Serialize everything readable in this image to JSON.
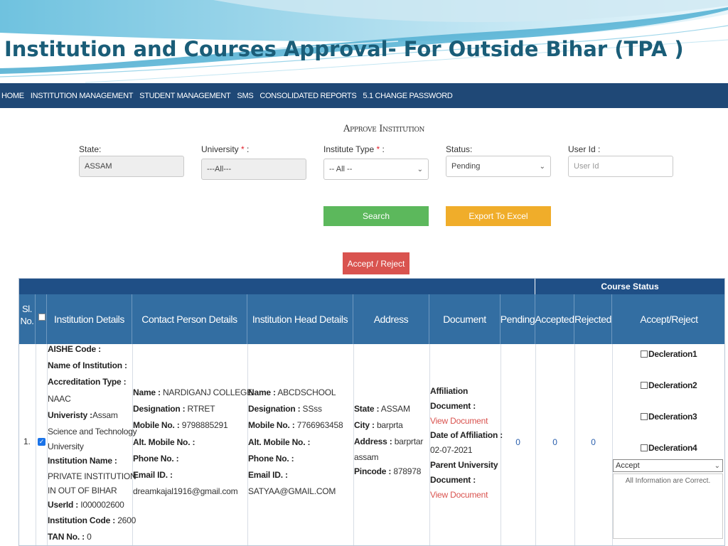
{
  "slide": {
    "title": "Institution and Courses Approval- For Outside Bihar (TPA )"
  },
  "nav": {
    "items": [
      "HOME",
      "INSTITUTION MANAGEMENT",
      "STUDENT MANAGEMENT",
      "SMS",
      "CONSOLIDATED REPORTS",
      "5.1 CHANGE PASSWORD"
    ]
  },
  "page": {
    "heading": "Approve Institution"
  },
  "filters": {
    "state": {
      "label": "State:",
      "value": "ASSAM"
    },
    "university": {
      "label": "University",
      "required": "*",
      "colon": ":",
      "value": "---All---"
    },
    "institute_type": {
      "label": "Institute Type",
      "required": "*",
      "colon": ":",
      "value": "-- All --"
    },
    "status": {
      "label": "Status:",
      "value": "Pending"
    },
    "user_id": {
      "label": "User Id :",
      "placeholder": "User Id"
    }
  },
  "buttons": {
    "search": "Search",
    "export": "Export To Excel",
    "accept_reject": "Accept / Reject"
  },
  "table": {
    "group_header": "Course Status",
    "headers": {
      "sl_no": "Sl. No.",
      "institution": "Institution Details",
      "contact": "Contact Person Details",
      "head": "Institution Head Details",
      "address": "Address",
      "document": "Document",
      "pending": "Pending",
      "accepted": "Accepted",
      "rejected": "Rejected",
      "accept_reject": "Accept/Reject"
    },
    "row": {
      "sl": "1.",
      "institution": {
        "aishe_label": "AISHE Code :",
        "name_label": "Name of Institution :",
        "accreditation_label": "Accreditation Type :",
        "accreditation_value": "NAAC",
        "university_label": "Univeristy :",
        "university_value_1": "Assam",
        "university_value_2": "Science and Technology",
        "university_value_3": "University",
        "inst_name_label": "Institution Name :",
        "inst_name_value_1": "PRIVATE INSTITUTION",
        "inst_name_value_2": "IN OUT OF BIHAR",
        "userid_label": "UserId :",
        "userid_value": "I000002600",
        "code_label": "Institution Code :",
        "code_value": "2600",
        "tan_label": "TAN No. :",
        "tan_value": "0"
      },
      "contact": {
        "name_label": "Name :",
        "name_value": "NARDIGANJ COLLEGE",
        "designation_label": "Designation :",
        "designation_value": "RTRET",
        "mobile_label": "Mobile No. :",
        "mobile_value": "9798885291",
        "alt_mobile_label": "Alt. Mobile No. :",
        "phone_label": "Phone No. :",
        "email_label": "Email ID. :",
        "email_value": "dreamkajal1916@gmail.com"
      },
      "head": {
        "name_label": "Name :",
        "name_value": "ABCDSCHOOL",
        "designation_label": "Designation :",
        "designation_value": "SSss",
        "mobile_label": "Mobile No. :",
        "mobile_value": "7766963458",
        "alt_mobile_label": "Alt. Mobile No. :",
        "phone_label": "Phone No. :",
        "email_label": "Email ID. :",
        "email_value": "SATYAA@GMAIL.COM"
      },
      "address": {
        "state_label": "State :",
        "state_value": "ASSAM",
        "city_label": "City :",
        "city_value": "barprta",
        "address_label": "Address :",
        "address_value_1": "barprtar",
        "address_value_2": "assam",
        "pincode_label": "Pincode :",
        "pincode_value": "878978"
      },
      "document": {
        "affiliation_label_1": "Affiliation",
        "affiliation_label_2": "Document :",
        "view_1": "View Document",
        "date_label": "Date of Affiliation :",
        "date_value": "02-07-2021",
        "parent_label_1": "Parent University",
        "parent_label_2": "Document :",
        "view_2": "View Document"
      },
      "pending": "0",
      "accepted": "0",
      "rejected": "0",
      "declarations": [
        "Decleration1",
        "Decleration2",
        "Decleration3",
        "Decleration4"
      ],
      "status_value": "Accept",
      "remark": "All Information are Correct."
    }
  },
  "colors": {
    "nav_bg": "#1f4876",
    "header_bg": "#336ea2",
    "title": "#1a5d78",
    "search": "#5cb85c",
    "export": "#f0ad2a",
    "accept_reject": "#d9534f",
    "link": "#d9534f",
    "count": "#2a5fad"
  }
}
